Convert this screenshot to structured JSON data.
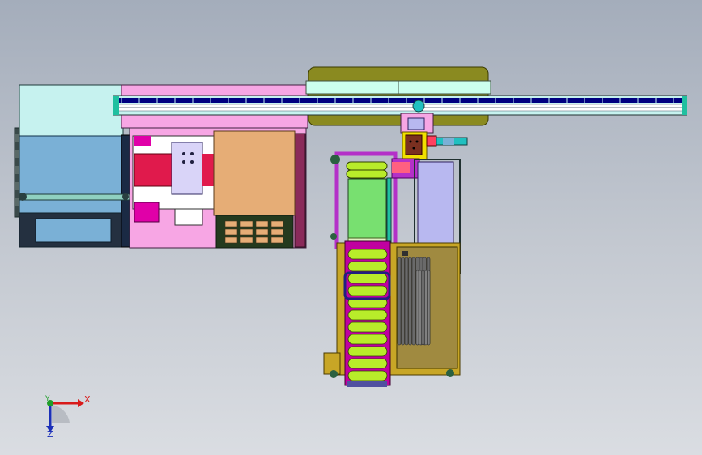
{
  "viewport": {
    "background_top": "#a4adbb",
    "background_bottom": "#dadde2"
  },
  "model": {
    "colors": {
      "cabinet_cyan": "#c6f2ef",
      "cabinet_blue": "#7ab0d6",
      "pink": "#f7a6e4",
      "magenta": "#e000a8",
      "red": "#e01a4c",
      "orange": "#e6ad76",
      "olive": "#8a8a20",
      "rail": "#000080",
      "green": "#78e070",
      "lime": "#b8ec2a",
      "gold": "#c8a626",
      "lavender": "#b8b8f0",
      "purple": "#b430c8",
      "yellow": "#f0e000"
    }
  },
  "triad": {
    "x_label": "X",
    "y_label": "Y",
    "z_label": "Z",
    "x_color": "#d81a1a",
    "y_color": "#1f9e2a",
    "z_color": "#1b2fb8"
  }
}
